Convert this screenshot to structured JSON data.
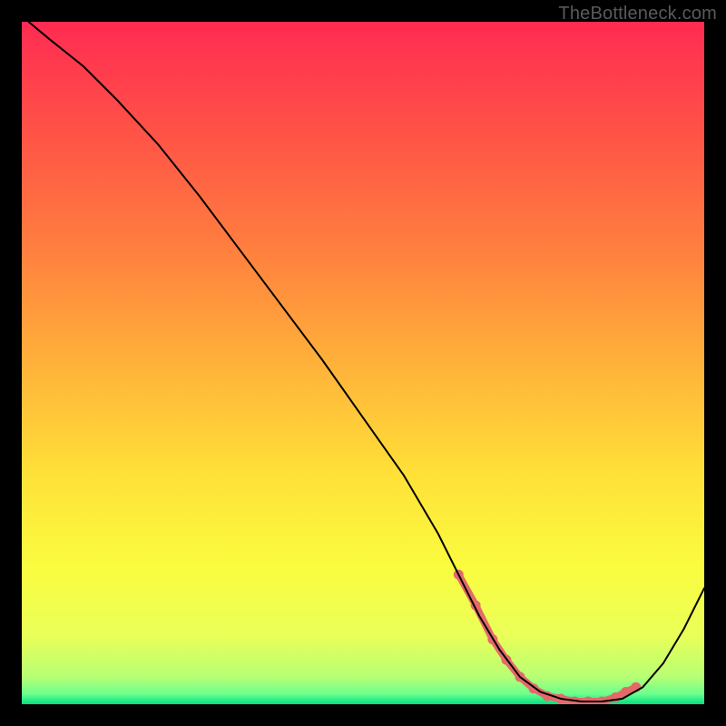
{
  "attribution": "TheBottleneck.com",
  "chart_data": {
    "type": "line",
    "title": "",
    "xlabel": "",
    "ylabel": "",
    "xlim": [
      0,
      100
    ],
    "ylim": [
      0,
      100
    ],
    "background_gradient": {
      "stops": [
        {
          "offset": 0.0,
          "color": "#ff2b52"
        },
        {
          "offset": 0.16,
          "color": "#ff5247"
        },
        {
          "offset": 0.33,
          "color": "#ff7e3f"
        },
        {
          "offset": 0.5,
          "color": "#ffb13a"
        },
        {
          "offset": 0.66,
          "color": "#ffe038"
        },
        {
          "offset": 0.8,
          "color": "#fafc3f"
        },
        {
          "offset": 0.9,
          "color": "#e9ff58"
        },
        {
          "offset": 0.96,
          "color": "#b7ff74"
        },
        {
          "offset": 0.985,
          "color": "#6cff8e"
        },
        {
          "offset": 1.0,
          "color": "#00e080"
        }
      ]
    },
    "series": [
      {
        "name": "bottleneck-curve",
        "color": "#000000",
        "width": 2,
        "x": [
          1,
          4,
          9,
          14,
          20,
          26,
          32,
          38,
          44,
          50,
          56,
          61,
          64,
          67,
          70,
          73,
          76,
          79,
          82,
          85,
          88,
          91,
          94,
          97,
          100
        ],
        "y": [
          100,
          97.5,
          93.5,
          88.5,
          82,
          74.5,
          66.5,
          58.5,
          50.5,
          42,
          33.5,
          25,
          19,
          13,
          8,
          4,
          1.8,
          0.8,
          0.4,
          0.4,
          0.8,
          2.5,
          6,
          11,
          17
        ]
      }
    ],
    "highlight": {
      "name": "optimal-zone",
      "color": "#e46a6a",
      "dot_radius": 5.5,
      "line_width": 8,
      "x": [
        64,
        66.5,
        69,
        71,
        73,
        75,
        77,
        79,
        81,
        83,
        85,
        87,
        88.5,
        90
      ],
      "y": [
        19,
        14.5,
        9.5,
        6.5,
        4,
        2.3,
        1.2,
        0.8,
        0.4,
        0.4,
        0.4,
        1.0,
        1.8,
        2.5
      ]
    }
  }
}
